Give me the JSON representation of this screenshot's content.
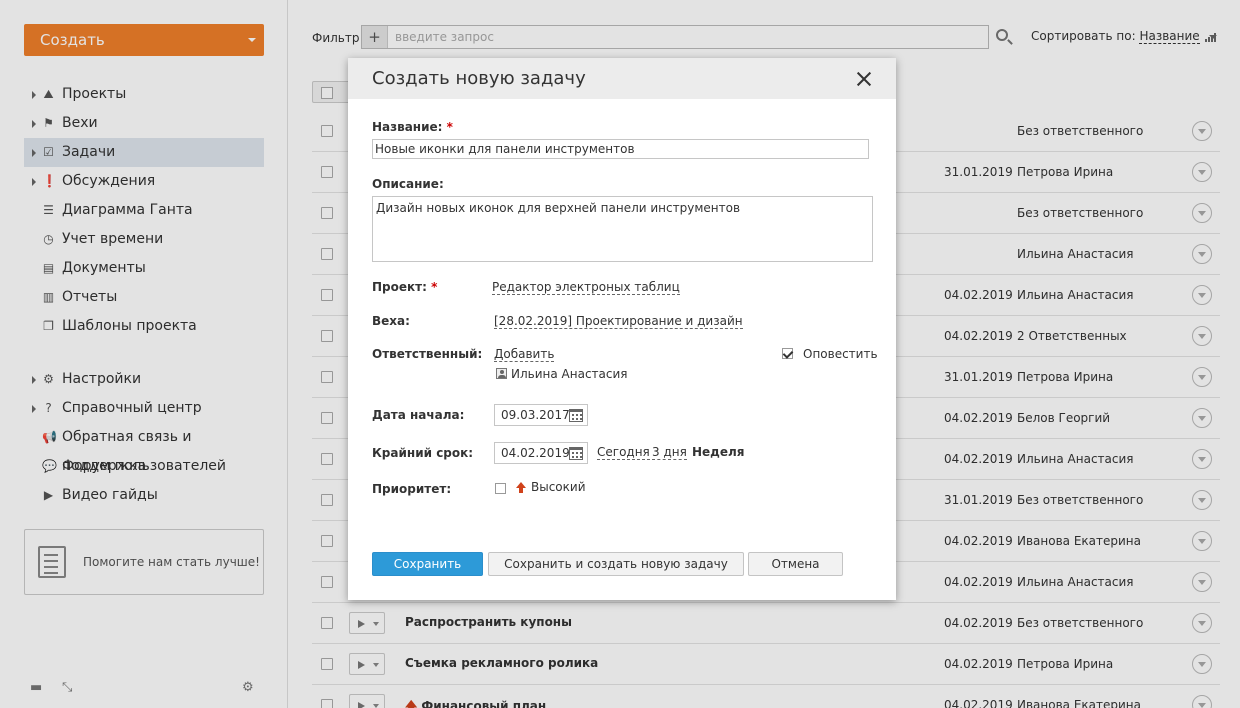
{
  "sidebar": {
    "create_label": "Создать",
    "nav": [
      {
        "label": "Проекты",
        "icon": "projects-icon",
        "glyph": "⛰",
        "arrow": true
      },
      {
        "label": "Вехи",
        "icon": "flag-icon",
        "glyph": "⚑",
        "arrow": true
      },
      {
        "label": "Задачи",
        "icon": "tasks-icon",
        "glyph": "☑",
        "arrow": true,
        "active": true
      },
      {
        "label": "Обсуждения",
        "icon": "discussion-icon",
        "glyph": "❗",
        "arrow": true
      },
      {
        "label": "Диаграмма Ганта",
        "icon": "gantt-icon",
        "glyph": "☰",
        "arrow": false
      },
      {
        "label": "Учет времени",
        "icon": "clock-icon",
        "glyph": "◷",
        "arrow": false
      },
      {
        "label": "Документы",
        "icon": "documents-icon",
        "glyph": "▤",
        "arrow": false
      },
      {
        "label": "Отчеты",
        "icon": "reports-icon",
        "glyph": "▥",
        "arrow": false
      },
      {
        "label": "Шаблоны проекта",
        "icon": "templates-icon",
        "glyph": "❐",
        "arrow": false
      }
    ],
    "nav2": [
      {
        "label": "Настройки",
        "icon": "gear-icon",
        "glyph": "⚙",
        "arrow": true
      },
      {
        "label": "Справочный центр",
        "icon": "help-icon",
        "glyph": "?",
        "arrow": true
      },
      {
        "label": "Обратная связь и поддержка",
        "icon": "megaphone-icon",
        "glyph": "📢",
        "arrow": false
      },
      {
        "label": "Форум пользователей",
        "icon": "forum-icon",
        "glyph": "💬",
        "arrow": false
      },
      {
        "label": "Видео гайды",
        "icon": "video-icon",
        "glyph": "▶",
        "arrow": false
      }
    ],
    "help_box_label": "Помогите нам стать лучше!"
  },
  "header": {
    "filter_label": "Фильтр",
    "filter_placeholder": "введите запрос",
    "sort_label": "Сортировать по:",
    "sort_value": "Название"
  },
  "tasks": [
    {
      "title": "",
      "date": "",
      "responsible": "Без ответственного",
      "priority": false
    },
    {
      "title": "",
      "date": "31.01.2019",
      "responsible": "Петрова Ирина",
      "priority": false
    },
    {
      "title": "",
      "date": "",
      "responsible": "Без ответственного",
      "priority": false
    },
    {
      "title": "",
      "date": "",
      "responsible": "Ильина Анастасия",
      "priority": false
    },
    {
      "title": "",
      "date": "04.02.2019",
      "responsible": "Ильина Анастасия",
      "priority": false
    },
    {
      "title": "",
      "date": "04.02.2019",
      "responsible": "2 Ответственных",
      "priority": false
    },
    {
      "title": "",
      "date": "31.01.2019",
      "responsible": "Петрова Ирина",
      "priority": false
    },
    {
      "title": "",
      "date": "04.02.2019",
      "responsible": "Белов Георгий",
      "priority": false
    },
    {
      "title": "",
      "date": "04.02.2019",
      "responsible": "Ильина Анастасия",
      "priority": false
    },
    {
      "title": "",
      "date": "31.01.2019",
      "responsible": "Без ответственного",
      "priority": false
    },
    {
      "title": "",
      "date": "04.02.2019",
      "responsible": "Иванова Екатерина",
      "priority": false
    },
    {
      "title": "",
      "date": "04.02.2019",
      "responsible": "Ильина Анастасия",
      "priority": false
    },
    {
      "title": "Распространить купоны",
      "date": "04.02.2019",
      "responsible": "Без ответственного",
      "priority": false
    },
    {
      "title": "Съемка рекламного ролика",
      "date": "04.02.2019",
      "responsible": "Петрова Ирина",
      "priority": false
    },
    {
      "title": "Финансовый план",
      "date": "04.02.2019",
      "responsible": "Иванова Екатерина",
      "priority": true
    }
  ],
  "modal": {
    "title": "Создать новую задачу",
    "name_label": "Название:",
    "name_value": "Новые иконки для панели инструментов",
    "description_label": "Описание:",
    "description_value": "Дизайн новых иконок для верхней панели инструментов",
    "project_label": "Проект:",
    "project_value": "Редактор электроных таблиц",
    "milestone_label": "Веха:",
    "milestone_value": "[28.02.2019] Проектирование и дизайн",
    "responsible_label": "Ответственный:",
    "add_label": "Добавить",
    "notify_label": "Оповестить",
    "notify_checked": true,
    "assignee": "Ильина Анастасия",
    "start_label": "Дата начала:",
    "start_value": "09.03.2017",
    "deadline_label": "Крайний срок:",
    "deadline_value": "04.02.2019",
    "quick_today": "Сегодня",
    "quick_3days": "3 дня",
    "quick_week": "Неделя",
    "priority_label": "Приоритет:",
    "priority_value": "Высокий",
    "priority_checked": false,
    "required_mark": "*",
    "save_label": "Сохранить",
    "save_new_label": "Сохранить и создать новую задачу",
    "cancel_label": "Отмена"
  }
}
